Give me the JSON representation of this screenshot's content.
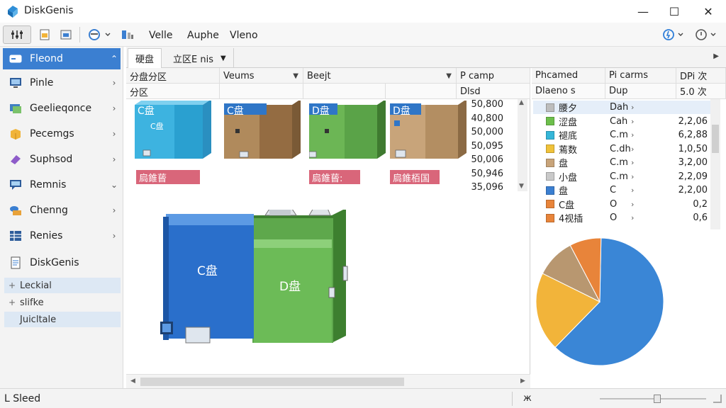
{
  "window": {
    "title": "DiskGenis",
    "minimize_glyph": "—",
    "maximize_glyph": "☐",
    "close_glyph": "✕"
  },
  "toolbar": {
    "menu_1": "Velle",
    "menu_2": "Auphe",
    "menu_3": "Vleno"
  },
  "sidebar": {
    "items": [
      {
        "label": "Fleond",
        "icon": "drive-icon",
        "chevron": "⌃"
      },
      {
        "label": "Pinle",
        "icon": "monitor-icon",
        "chevron": "›"
      },
      {
        "label": "Geelieqonce",
        "icon": "network-icon",
        "chevron": "›"
      },
      {
        "label": "Pecemgs",
        "icon": "package-icon",
        "chevron": "›"
      },
      {
        "label": "Suphsod",
        "icon": "eraser-icon",
        "chevron": "›"
      },
      {
        "label": "Remnis",
        "icon": "chat-icon",
        "chevron": "⌄"
      },
      {
        "label": "Chenng",
        "icon": "cloud-drive-icon",
        "chevron": "›"
      },
      {
        "label": "Renies",
        "icon": "grid-icon",
        "chevron": "›"
      },
      {
        "label": "DiskGenis",
        "icon": "document-icon",
        "chevron": ""
      }
    ],
    "subitems": [
      {
        "mark": "+",
        "label": "Leckial"
      },
      {
        "mark": "+",
        "label": "slifke"
      },
      {
        "mark": "",
        "label": "Juicltale"
      }
    ]
  },
  "tabs": [
    {
      "label": "硬盘"
    },
    {
      "label": "立区E nis"
    }
  ],
  "main": {
    "header_row_1": [
      "分盘分区",
      "Veums",
      "Beejt",
      "P camp"
    ],
    "header_row_2": [
      "分区",
      "",
      "",
      "",
      "Dlsd"
    ],
    "disks": [
      {
        "label": "C盘",
        "sub": "C盘",
        "badge": "扃錐蒈",
        "color": "#2fa6d6"
      },
      {
        "label": "C盘",
        "sub": "",
        "badge": "",
        "color": "#a67c4e"
      },
      {
        "label": "D盘",
        "sub": "",
        "badge": "扃錐蒈:",
        "color": "#5aa84a"
      },
      {
        "label": "D盘",
        "sub": "",
        "badge": "扃錐栢国",
        "color": "#b89468"
      }
    ],
    "numbers": [
      "50,800",
      "40,800",
      "50,000",
      "50,095",
      "50,006",
      "50,946",
      "35,096"
    ],
    "big_disk_c": "C盘",
    "big_disk_d": "D盘"
  },
  "right": {
    "headers": [
      "Phcamed",
      "Pi carms",
      "DPi 次"
    ],
    "subheaders": [
      "Dlaeno s",
      "Dup",
      "5.0 次"
    ],
    "rows": [
      {
        "name": "腰夕",
        "val": "Dah",
        "size": "",
        "color": "#bdbdbd"
      },
      {
        "name": "涩盘",
        "val": "Cah",
        "size": "2,2,06",
        "color": "#6dbf4b"
      },
      {
        "name": "褪底",
        "val": "C.m",
        "size": "6,2,88",
        "color": "#35b6d8"
      },
      {
        "name": "蔫数",
        "val": "C.dh",
        "size": "1,0,50",
        "color": "#f0c23a"
      },
      {
        "name": "盘",
        "val": "C.m",
        "size": "3,2,00",
        "color": "#c8a47a"
      },
      {
        "name": "小盘",
        "val": "C.m",
        "size": "2,2,09",
        "color": "#c9c9c9"
      },
      {
        "name": "盘",
        "val": "C",
        "size": "2,2,00",
        "color": "#3b7fd1"
      },
      {
        "name": "C盘",
        "val": "O",
        "size": "0,2",
        "color": "#e8843a"
      },
      {
        "name": "4视插",
        "val": "O",
        "size": "0,6",
        "color": "#e8843a"
      }
    ]
  },
  "pie": {
    "slices": [
      {
        "label": "blue",
        "value": 62,
        "color": "#3a86d6"
      },
      {
        "label": "yellow",
        "value": 20,
        "color": "#f2b43a"
      },
      {
        "label": "tan",
        "value": 10,
        "color": "#b89770"
      },
      {
        "label": "orange",
        "value": 8,
        "color": "#e8843a"
      }
    ]
  },
  "status": {
    "left": "L Sleed",
    "mid": "ж"
  }
}
